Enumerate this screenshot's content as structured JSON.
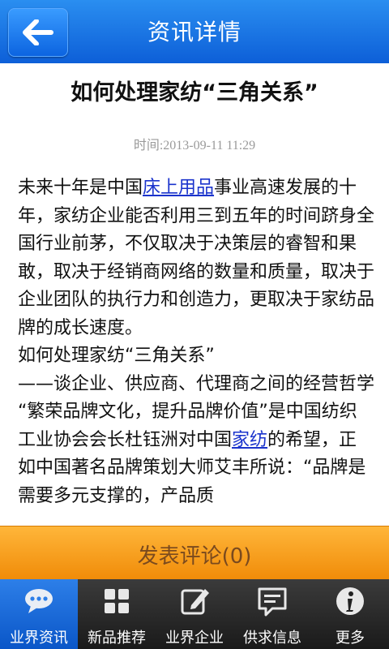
{
  "header": {
    "title": "资讯详情"
  },
  "article": {
    "title": "如何处理家纺“三角关系”",
    "time": "时间:2013-09-11 11:29",
    "p1_a": "未来十年是中国",
    "p1_link": "床上用品",
    "p1_b": "事业高速发展的十年，家纺企业能否利用三到五年的时间跻身全国行业前茅，不仅取决于决策层的睿智和果敢，取决于经销商网络的数量和质量，取决于企业团队的执行力和创造力，更取决于家纺品牌的成长速度。",
    "p2": "如何处理家纺“三角关系”",
    "p3": "——谈企业、供应商、代理商之间的经营哲学",
    "p4_a": "“繁荣品牌文化，提升品牌价值”是中国纺织工业协会会长杜钰洲对中国",
    "p4_link": "家纺",
    "p4_b": "的希望，正如中国著名品牌策划大师艾丰所说：“品牌是需要多元支撑的，产品质"
  },
  "comment": {
    "label": "发表评论(0)"
  },
  "tabs": [
    {
      "label": "业界资讯",
      "icon": "chat-bubbles-icon"
    },
    {
      "label": "新品推荐",
      "icon": "grid-icon"
    },
    {
      "label": "业界企业",
      "icon": "edit-icon"
    },
    {
      "label": "供求信息",
      "icon": "message-icon"
    },
    {
      "label": "更多",
      "icon": "info-icon"
    }
  ]
}
